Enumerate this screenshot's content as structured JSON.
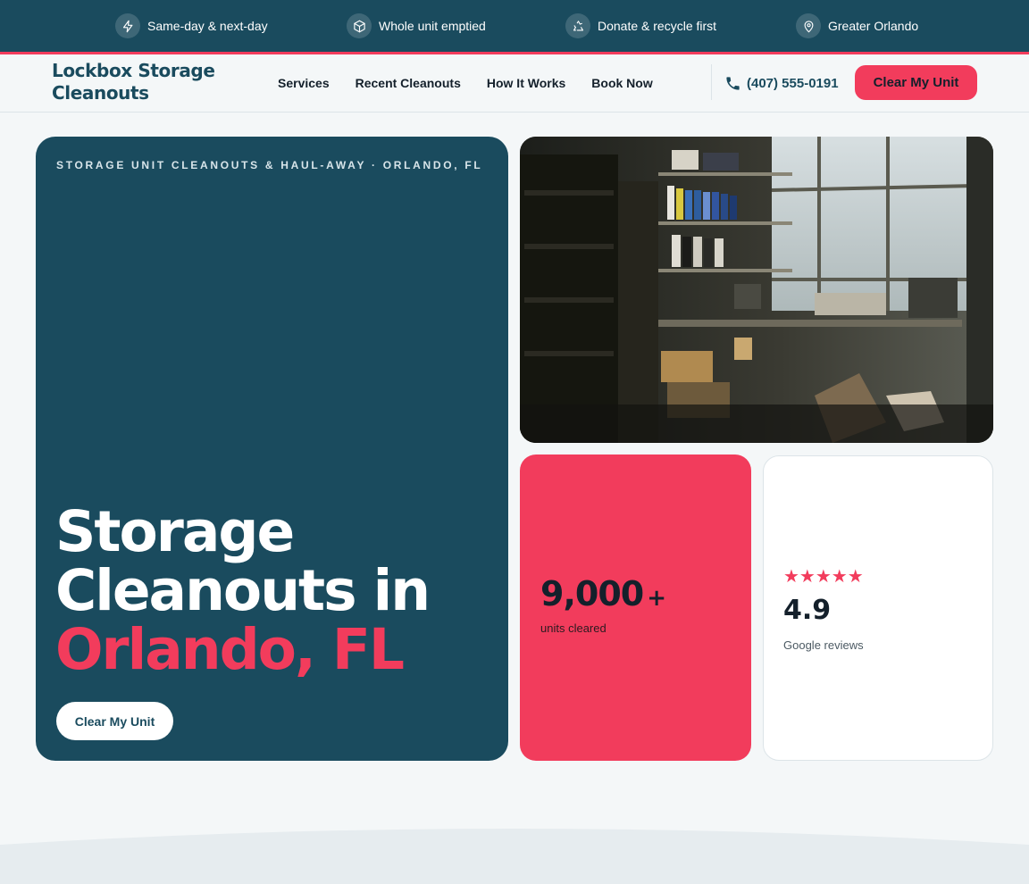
{
  "topbar": {
    "items": [
      {
        "label": "Same-day & next-day",
        "icon": "lightning-icon"
      },
      {
        "label": "Whole unit emptied",
        "icon": "box-icon"
      },
      {
        "label": "Donate & recycle first",
        "icon": "recycle-icon"
      },
      {
        "label": "Greater Orlando",
        "icon": "map-pin-icon"
      }
    ]
  },
  "header": {
    "brand_line1": "Lockbox Storage",
    "brand_line2": "Cleanouts",
    "nav": [
      "Services",
      "Recent Cleanouts",
      "How It Works",
      "Book Now"
    ],
    "phone": "(407) 555-0191",
    "cta": "Clear My Unit"
  },
  "hero": {
    "eyebrow": "STORAGE UNIT CLEANOUTS & HAUL-AWAY · ORLANDO, FL",
    "headline_line1": "Storage",
    "headline_line2": "Cleanouts in",
    "headline_accent": "Orlando, FL",
    "cta": "Clear My Unit"
  },
  "stats": {
    "units_value": "9,000",
    "units_suffix": "+",
    "units_label": "units cleared",
    "stars": "★★★★★",
    "star_count": 5,
    "rating": "4.9",
    "rating_label": "Google reviews"
  },
  "colors": {
    "primary": "#1a4b5e",
    "accent": "#f23c5c",
    "background": "#f4f7f8"
  }
}
